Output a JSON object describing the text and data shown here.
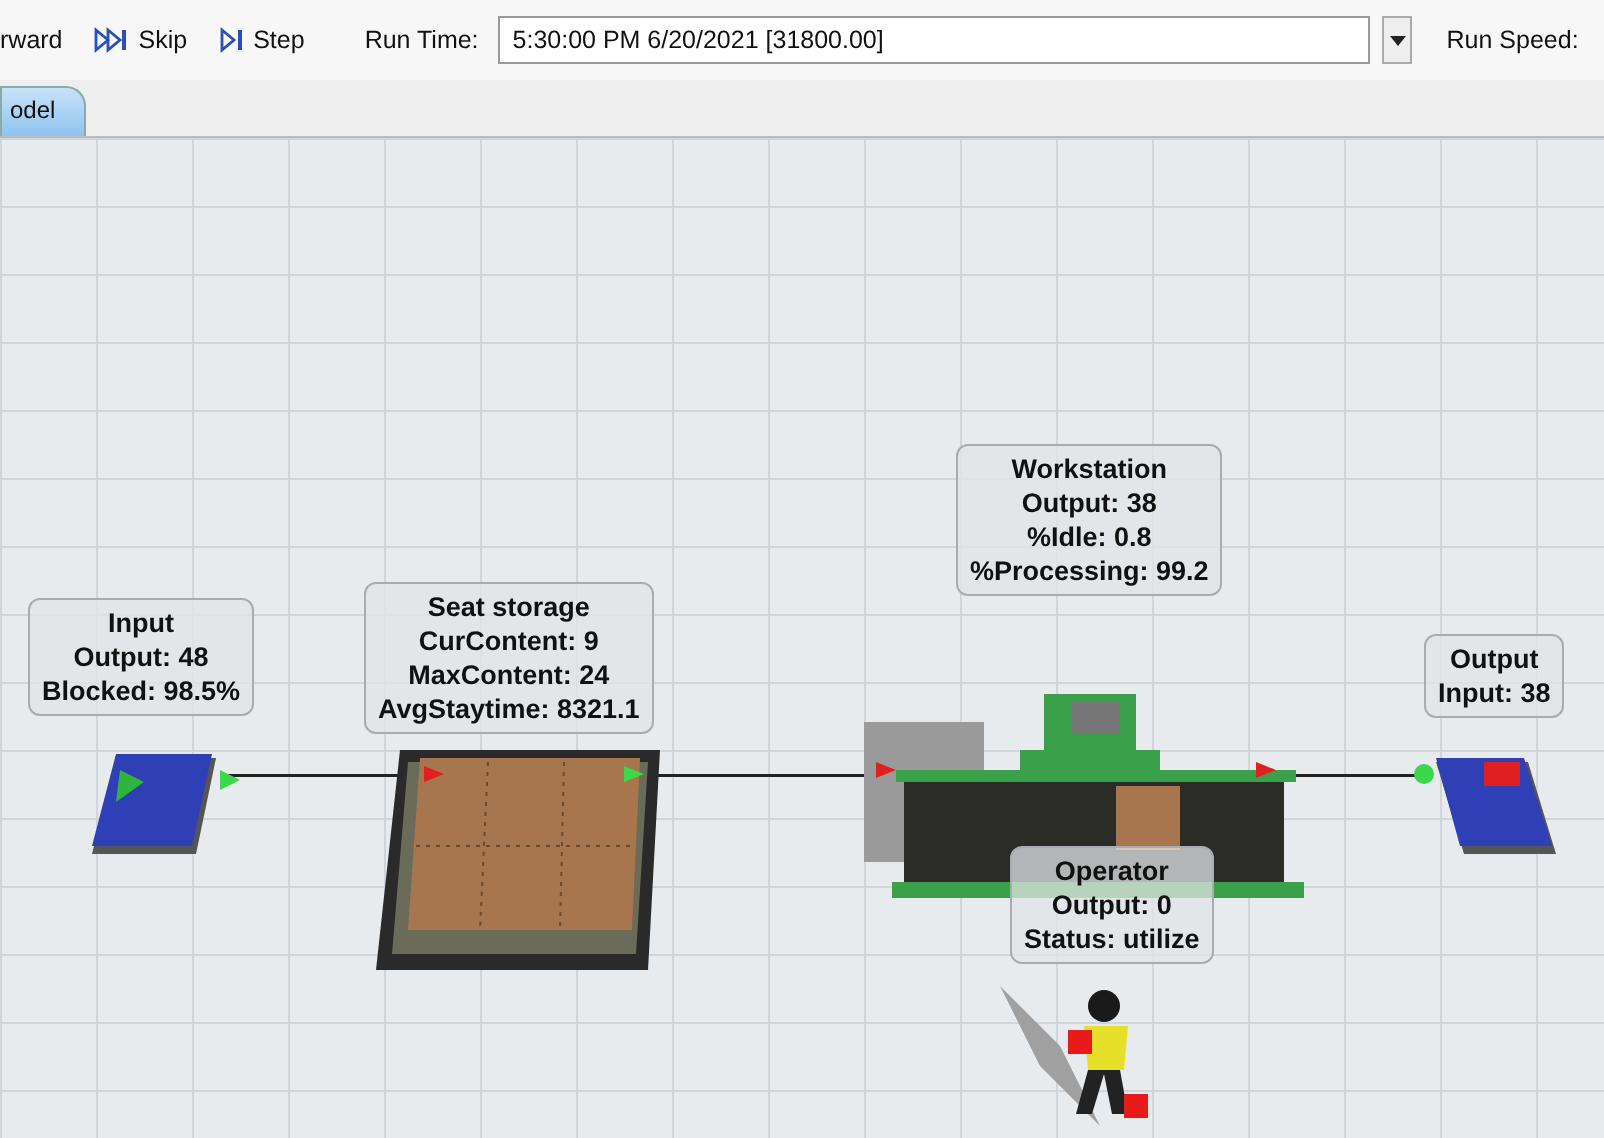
{
  "toolbar": {
    "buttons": [
      {
        "kind": "text",
        "label": "rward"
      },
      {
        "kind": "skip",
        "label": "Skip"
      },
      {
        "kind": "step",
        "label": "Step"
      }
    ],
    "run_time": {
      "label": "Run Time:",
      "value": "5:30:00 PM  6/20/2021  [31800.00]"
    },
    "run_speed": {
      "label": "Run Speed:"
    }
  },
  "tabs": [
    {
      "label": "odel",
      "selected": true
    }
  ],
  "objects": [
    {
      "kind": "source",
      "lines": [
        "Input",
        "Output: 48",
        "Blocked: 98.5%"
      ]
    },
    {
      "kind": "queue",
      "lines": [
        "Seat storage",
        "CurContent:  9",
        "MaxContent:  24",
        "AvgStaytime: 8321.1"
      ]
    },
    {
      "kind": "processor",
      "lines": [
        "Workstation",
        "Output: 38",
        "%Idle:  0.8",
        "%Processing: 99.2"
      ]
    },
    {
      "kind": "sink",
      "lines": [
        "Output",
        "Input: 38"
      ]
    },
    {
      "kind": "operator",
      "lines": [
        "Operator",
        "Output: 0",
        "Status: utilize"
      ]
    }
  ]
}
